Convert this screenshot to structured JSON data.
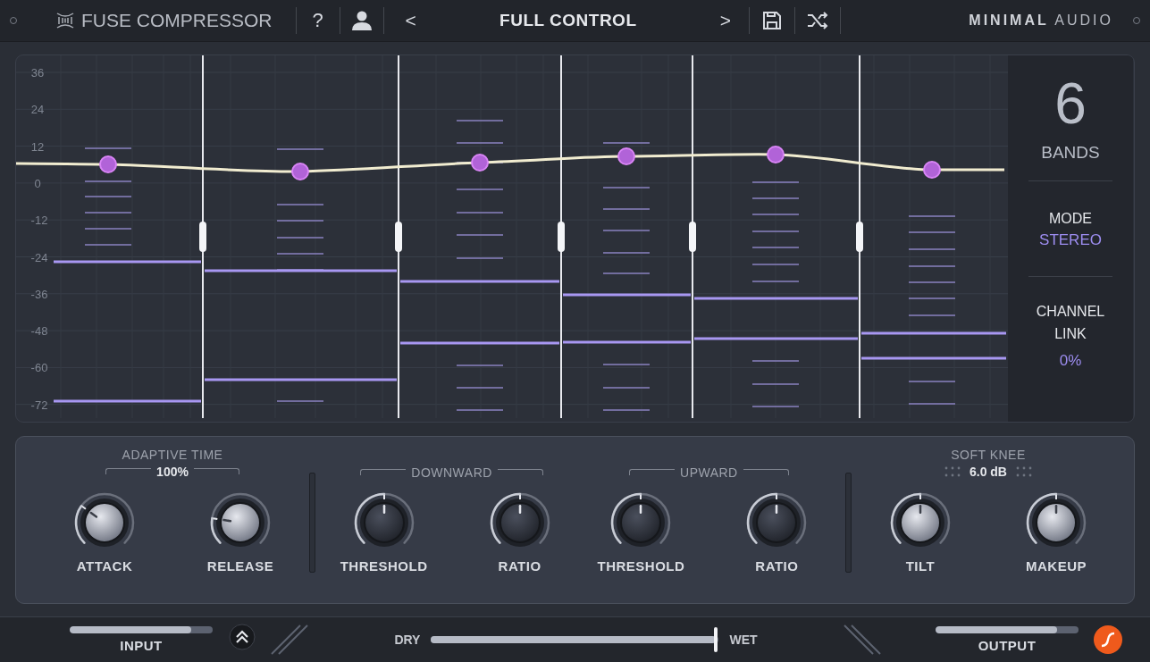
{
  "header": {
    "title": "FUSE COMPRESSOR",
    "help": "?",
    "prev": "<",
    "preset": "FULL CONTROL",
    "next": ">",
    "brand_bold": "MINIMAL",
    "brand_light": "AUDIO"
  },
  "graph": {
    "y_labels": [
      "36",
      "24",
      "12",
      "0",
      "-12",
      "-24",
      "-36",
      "-48",
      "-60",
      "-72"
    ],
    "bands_count": "6",
    "bands_label": "BANDS",
    "mode_label": "MODE",
    "mode_value": "STEREO",
    "link_label": "CHANNEL LINK",
    "link_value": "0%"
  },
  "controls": {
    "groups": [
      {
        "kind": "value",
        "title": "ADAPTIVE TIME",
        "value": "100%",
        "knobs": [
          {
            "label": "ATTACK",
            "kind": "metal",
            "level": 0.3
          },
          {
            "label": "RELEASE",
            "kind": "metal",
            "level": 0.2
          }
        ]
      },
      {
        "kind": "bracket",
        "title": "DOWNWARD",
        "knobs": [
          {
            "label": "THRESHOLD",
            "kind": "dark",
            "level": 0.5
          },
          {
            "label": "RATIO",
            "kind": "dark",
            "level": 0.5
          }
        ]
      },
      {
        "kind": "bracket",
        "title": "UPWARD",
        "knobs": [
          {
            "label": "THRESHOLD",
            "kind": "dark",
            "level": 0.5
          },
          {
            "label": "RATIO",
            "kind": "dark",
            "level": 0.5
          }
        ]
      },
      {
        "kind": "dots",
        "title": "SOFT KNEE",
        "value": "6.0 dB",
        "knobs": [
          {
            "label": "TILT",
            "kind": "metal",
            "level": 0.5
          },
          {
            "label": "MAKEUP",
            "kind": "metal",
            "level": 0.5
          }
        ]
      }
    ]
  },
  "footer": {
    "input": {
      "label": "INPUT",
      "level": 0.85
    },
    "dry": "DRY",
    "wet": "WET",
    "mix": {
      "level": 0.99
    },
    "output": {
      "label": "OUTPUT",
      "level": 0.85
    }
  }
}
